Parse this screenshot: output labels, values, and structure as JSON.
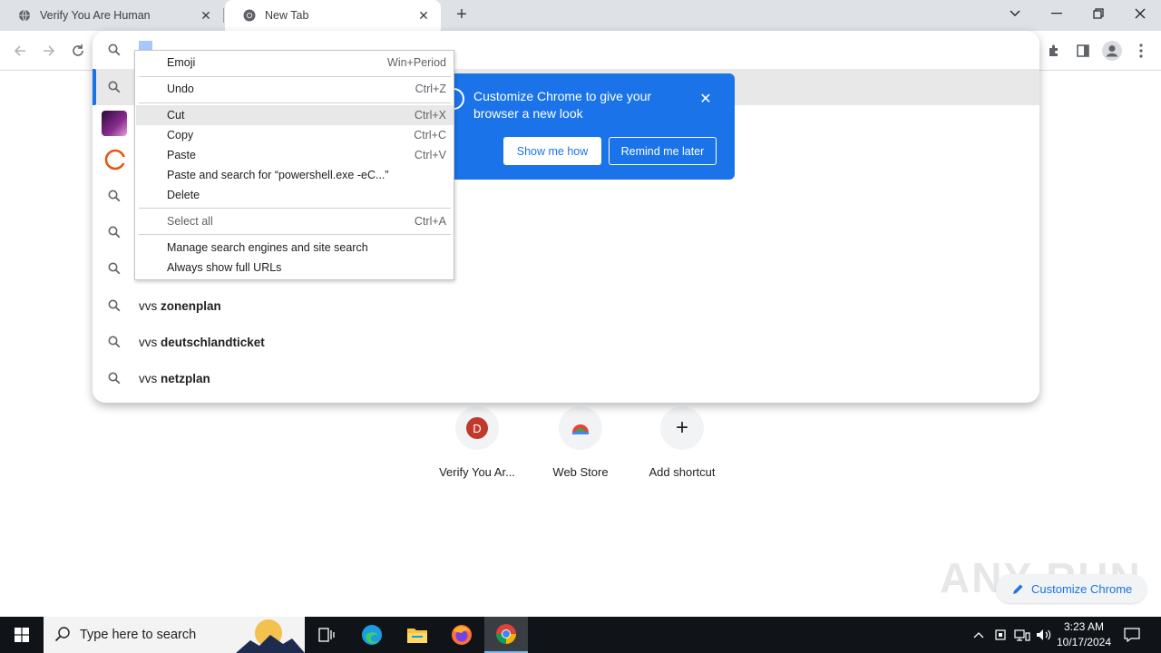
{
  "tabs": [
    {
      "title": "Verify You Are Human",
      "active": false
    },
    {
      "title": "New Tab",
      "active": true
    }
  ],
  "omnibox": {
    "selected_text": "vvs",
    "suggestions": [
      {
        "prefix": "vvs ",
        "bold": "zonenplan"
      },
      {
        "prefix": "vvs ",
        "bold": "deutschlandticket"
      },
      {
        "prefix": "vvs ",
        "bold": "netzplan"
      }
    ]
  },
  "context_menu": {
    "items": [
      {
        "label": "Emoji",
        "shortcut": "Win+Period"
      },
      {
        "label": "Undo",
        "shortcut": "Ctrl+Z"
      },
      {
        "label": "Cut",
        "shortcut": "Ctrl+X"
      },
      {
        "label": "Copy",
        "shortcut": "Ctrl+C"
      },
      {
        "label": "Paste",
        "shortcut": "Ctrl+V"
      },
      {
        "label": "Paste and search for “powershell.exe -eC...”",
        "shortcut": ""
      },
      {
        "label": "Delete",
        "shortcut": ""
      },
      {
        "label": "Select all",
        "shortcut": "Ctrl+A"
      },
      {
        "label": "Manage search engines and site search",
        "shortcut": ""
      },
      {
        "label": "Always show full URLs",
        "shortcut": ""
      }
    ]
  },
  "promo": {
    "text": "Customize Chrome to give your browser a new look",
    "primary_button": "Show me how",
    "secondary_button": "Remind me later"
  },
  "shortcuts": [
    {
      "label": "Verify You Ar...",
      "initial": "D",
      "color": "#c0392b"
    },
    {
      "label": "Web Store"
    },
    {
      "label": "Add shortcut",
      "symbol": "+"
    }
  ],
  "customize_button": "Customize Chrome",
  "watermark": "ANY RUN",
  "taskbar": {
    "search_placeholder": "Type here to search",
    "time": "3:23 AM",
    "date": "10/17/2024"
  },
  "colors": {
    "accent": "#1a73e8",
    "taskbar": "#101418"
  }
}
